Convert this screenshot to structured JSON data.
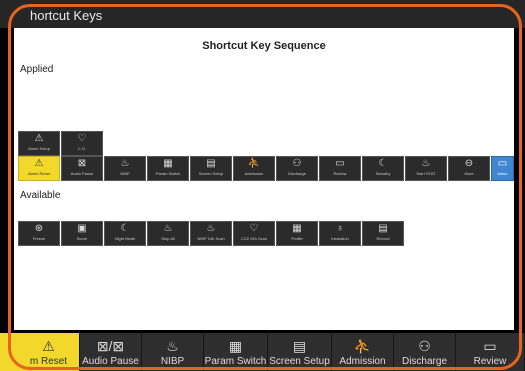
{
  "window_title": "hortcut Keys",
  "sequence_title": "Shortcut Key Sequence",
  "applied_label": "Applied",
  "available_label": "Available",
  "applied_row1": [
    {
      "label": "Alarm Setup",
      "icon": "alarm-setup-icon",
      "glyph": "⚠"
    },
    {
      "label": "C.O.",
      "icon": "heart-output-icon",
      "glyph": "♡"
    }
  ],
  "applied_row2": [
    {
      "label": "Alarm Reset",
      "icon": "alarm-reset-icon",
      "glyph": "⚠"
    },
    {
      "label": "Audio Pause",
      "icon": "audio-pause-icon",
      "glyph": "⊠"
    },
    {
      "label": "NIBP",
      "icon": "nibp-cuff-icon",
      "glyph": "♨"
    },
    {
      "label": "Param Switch",
      "icon": "param-switch-icon",
      "glyph": "▦"
    },
    {
      "label": "Screen Setup",
      "icon": "screen-setup-icon",
      "glyph": "▤"
    },
    {
      "label": "Admission",
      "icon": "admission-icon",
      "glyph": "⛹"
    },
    {
      "label": "Discharge",
      "icon": "discharge-icon",
      "glyph": "⚇"
    },
    {
      "label": "Review",
      "icon": "review-icon",
      "glyph": "▭"
    },
    {
      "label": "Standby",
      "icon": "standby-icon",
      "glyph": "☾"
    },
    {
      "label": "Start STAT",
      "icon": "start-stat-icon",
      "glyph": "♨"
    },
    {
      "label": "More",
      "icon": "more-icon",
      "glyph": "⊖"
    },
    {
      "label": "Menu",
      "icon": "menu-icon",
      "glyph": "▭"
    }
  ],
  "available_keys": [
    {
      "label": "Freeze",
      "icon": "freeze-icon",
      "glyph": "⊛"
    },
    {
      "label": "Score",
      "icon": "score-icon",
      "glyph": "▣"
    },
    {
      "label": "Night Mode",
      "icon": "night-mode-icon",
      "glyph": "☾"
    },
    {
      "label": "Stop All",
      "icon": "stop-all-icon",
      "glyph": "♨"
    },
    {
      "label": "NIBP 24h Scan",
      "icon": "nibp-24h-icon",
      "glyph": "♨"
    },
    {
      "label": "CO2 24h Scan",
      "icon": "co2-24h-icon",
      "glyph": "♡"
    },
    {
      "label": "Profile",
      "icon": "profile-icon",
      "glyph": "▦"
    },
    {
      "label": "Intubation",
      "icon": "intubation-icon",
      "glyph": "♁"
    },
    {
      "label": "Record",
      "icon": "record-icon",
      "glyph": "▤"
    }
  ],
  "bottom_bar": [
    {
      "label": "m Reset",
      "icon": "alarm-reset-icon",
      "glyph": "⚠"
    },
    {
      "label": "Audio Pause",
      "icon": "audio-pause-icon",
      "glyph": "⊠/⊠"
    },
    {
      "label": "NIBP",
      "icon": "nibp-cuff-icon",
      "glyph": "♨"
    },
    {
      "label": "Param Switch",
      "icon": "param-switch-icon",
      "glyph": "▦"
    },
    {
      "label": "Screen Setup",
      "icon": "screen-setup-icon",
      "glyph": "▤"
    },
    {
      "label": "Admission",
      "icon": "admission-icon",
      "glyph": "⛹"
    },
    {
      "label": "Discharge",
      "icon": "discharge-icon",
      "glyph": "⚇"
    },
    {
      "label": "Review",
      "icon": "review-icon",
      "glyph": "▭"
    }
  ],
  "colors": {
    "accent_frame": "#e8641e",
    "selected_yellow": "#f2d82a",
    "menu_blue": "#3f86cf",
    "key_dark": "#2b2b2b"
  }
}
